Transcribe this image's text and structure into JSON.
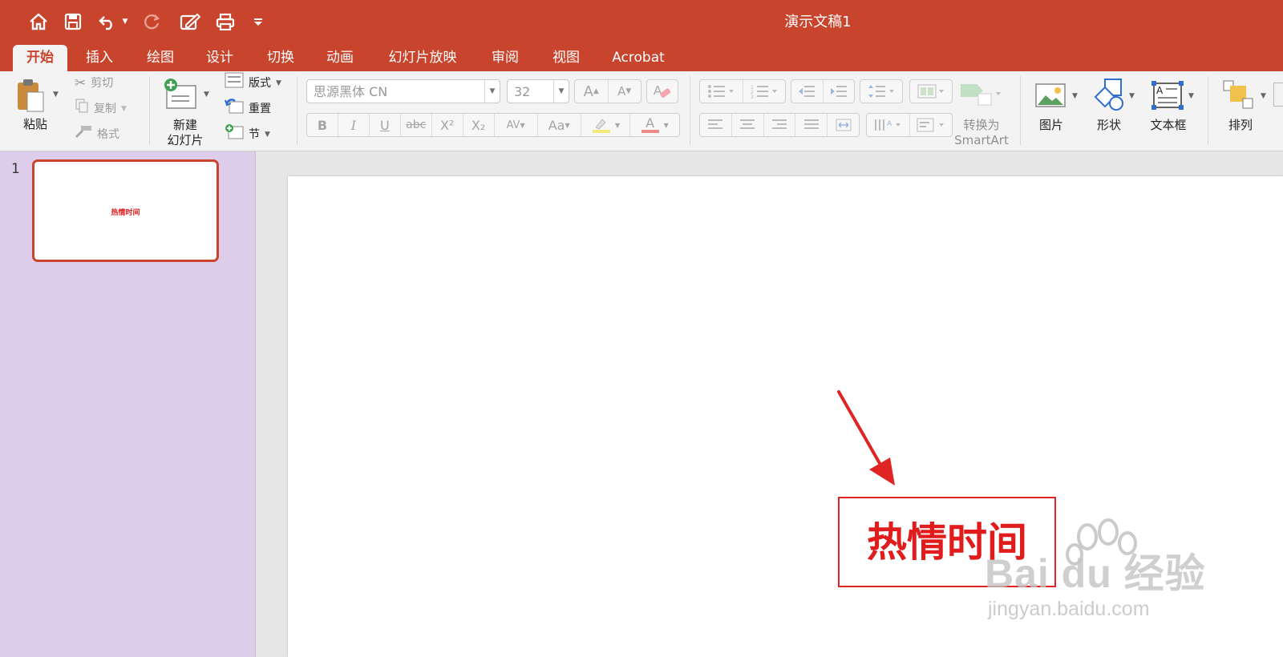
{
  "window": {
    "title": "演示文稿1"
  },
  "quick_access": {
    "icons": [
      "home-icon",
      "save-icon",
      "undo-icon",
      "undo-dropdown-icon",
      "redo-icon",
      "edit-icon",
      "print-icon",
      "customize-icon"
    ]
  },
  "tabs": [
    {
      "label": "开始",
      "active": true
    },
    {
      "label": "插入"
    },
    {
      "label": "绘图"
    },
    {
      "label": "设计"
    },
    {
      "label": "切换"
    },
    {
      "label": "动画"
    },
    {
      "label": "幻灯片放映"
    },
    {
      "label": "审阅"
    },
    {
      "label": "视图"
    },
    {
      "label": "Acrobat"
    }
  ],
  "ribbon": {
    "paste_label": "粘贴",
    "cut_label": "剪切",
    "copy_label": "复制",
    "format_label": "格式",
    "new_slide_label_1": "新建",
    "new_slide_label_2": "幻灯片",
    "layout_label": "版式",
    "reset_label": "重置",
    "section_label": "节",
    "font_name": "思源黑体 CN",
    "font_size": "32",
    "bold": "B",
    "italic": "I",
    "underline": "U",
    "strike": "abc",
    "superscript": "X²",
    "subscript": "X₂",
    "char_spacing": "AV",
    "change_case": "Aa",
    "font_color": "A",
    "grow_font": "A",
    "shrink_font": "A",
    "smartart_label_1": "转换为",
    "smartart_label_2": "SmartArt",
    "picture_label": "图片",
    "shapes_label": "形状",
    "textbox_label": "文本框",
    "arrange_label": "排列"
  },
  "thumbnails": [
    {
      "number": "1",
      "text": "热情时间"
    }
  ],
  "slide": {
    "textbox_text": "热情时间"
  },
  "watermark": {
    "brand": "Bai du 经验",
    "url": "jingyan.baidu.com"
  },
  "colors": {
    "accent": "#c8442c",
    "thumbnail_pane": "#decdea",
    "text_red": "#e01c1c"
  }
}
